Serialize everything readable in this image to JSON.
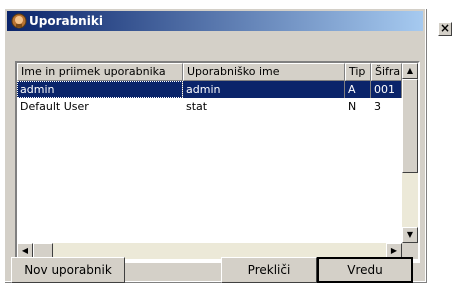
{
  "window": {
    "title": "Uporabniki",
    "close_label": "×"
  },
  "table": {
    "columns": [
      "Ime in priimek uporabnika",
      "Uporabniško ime",
      "Tip",
      "Šifra"
    ],
    "rows": [
      {
        "name": "admin",
        "username": "admin",
        "type": "A",
        "code": "001",
        "selected": true
      },
      {
        "name": "Default User",
        "username": "stat",
        "type": "N",
        "code": "3",
        "selected": false
      }
    ]
  },
  "buttons": {
    "new_user": "Nov uporabnik",
    "cancel": "Prekliči",
    "ok": "Vredu"
  },
  "icons": {
    "title": "user-icon",
    "up": "▲",
    "down": "▼",
    "left": "◀",
    "right": "▶"
  }
}
